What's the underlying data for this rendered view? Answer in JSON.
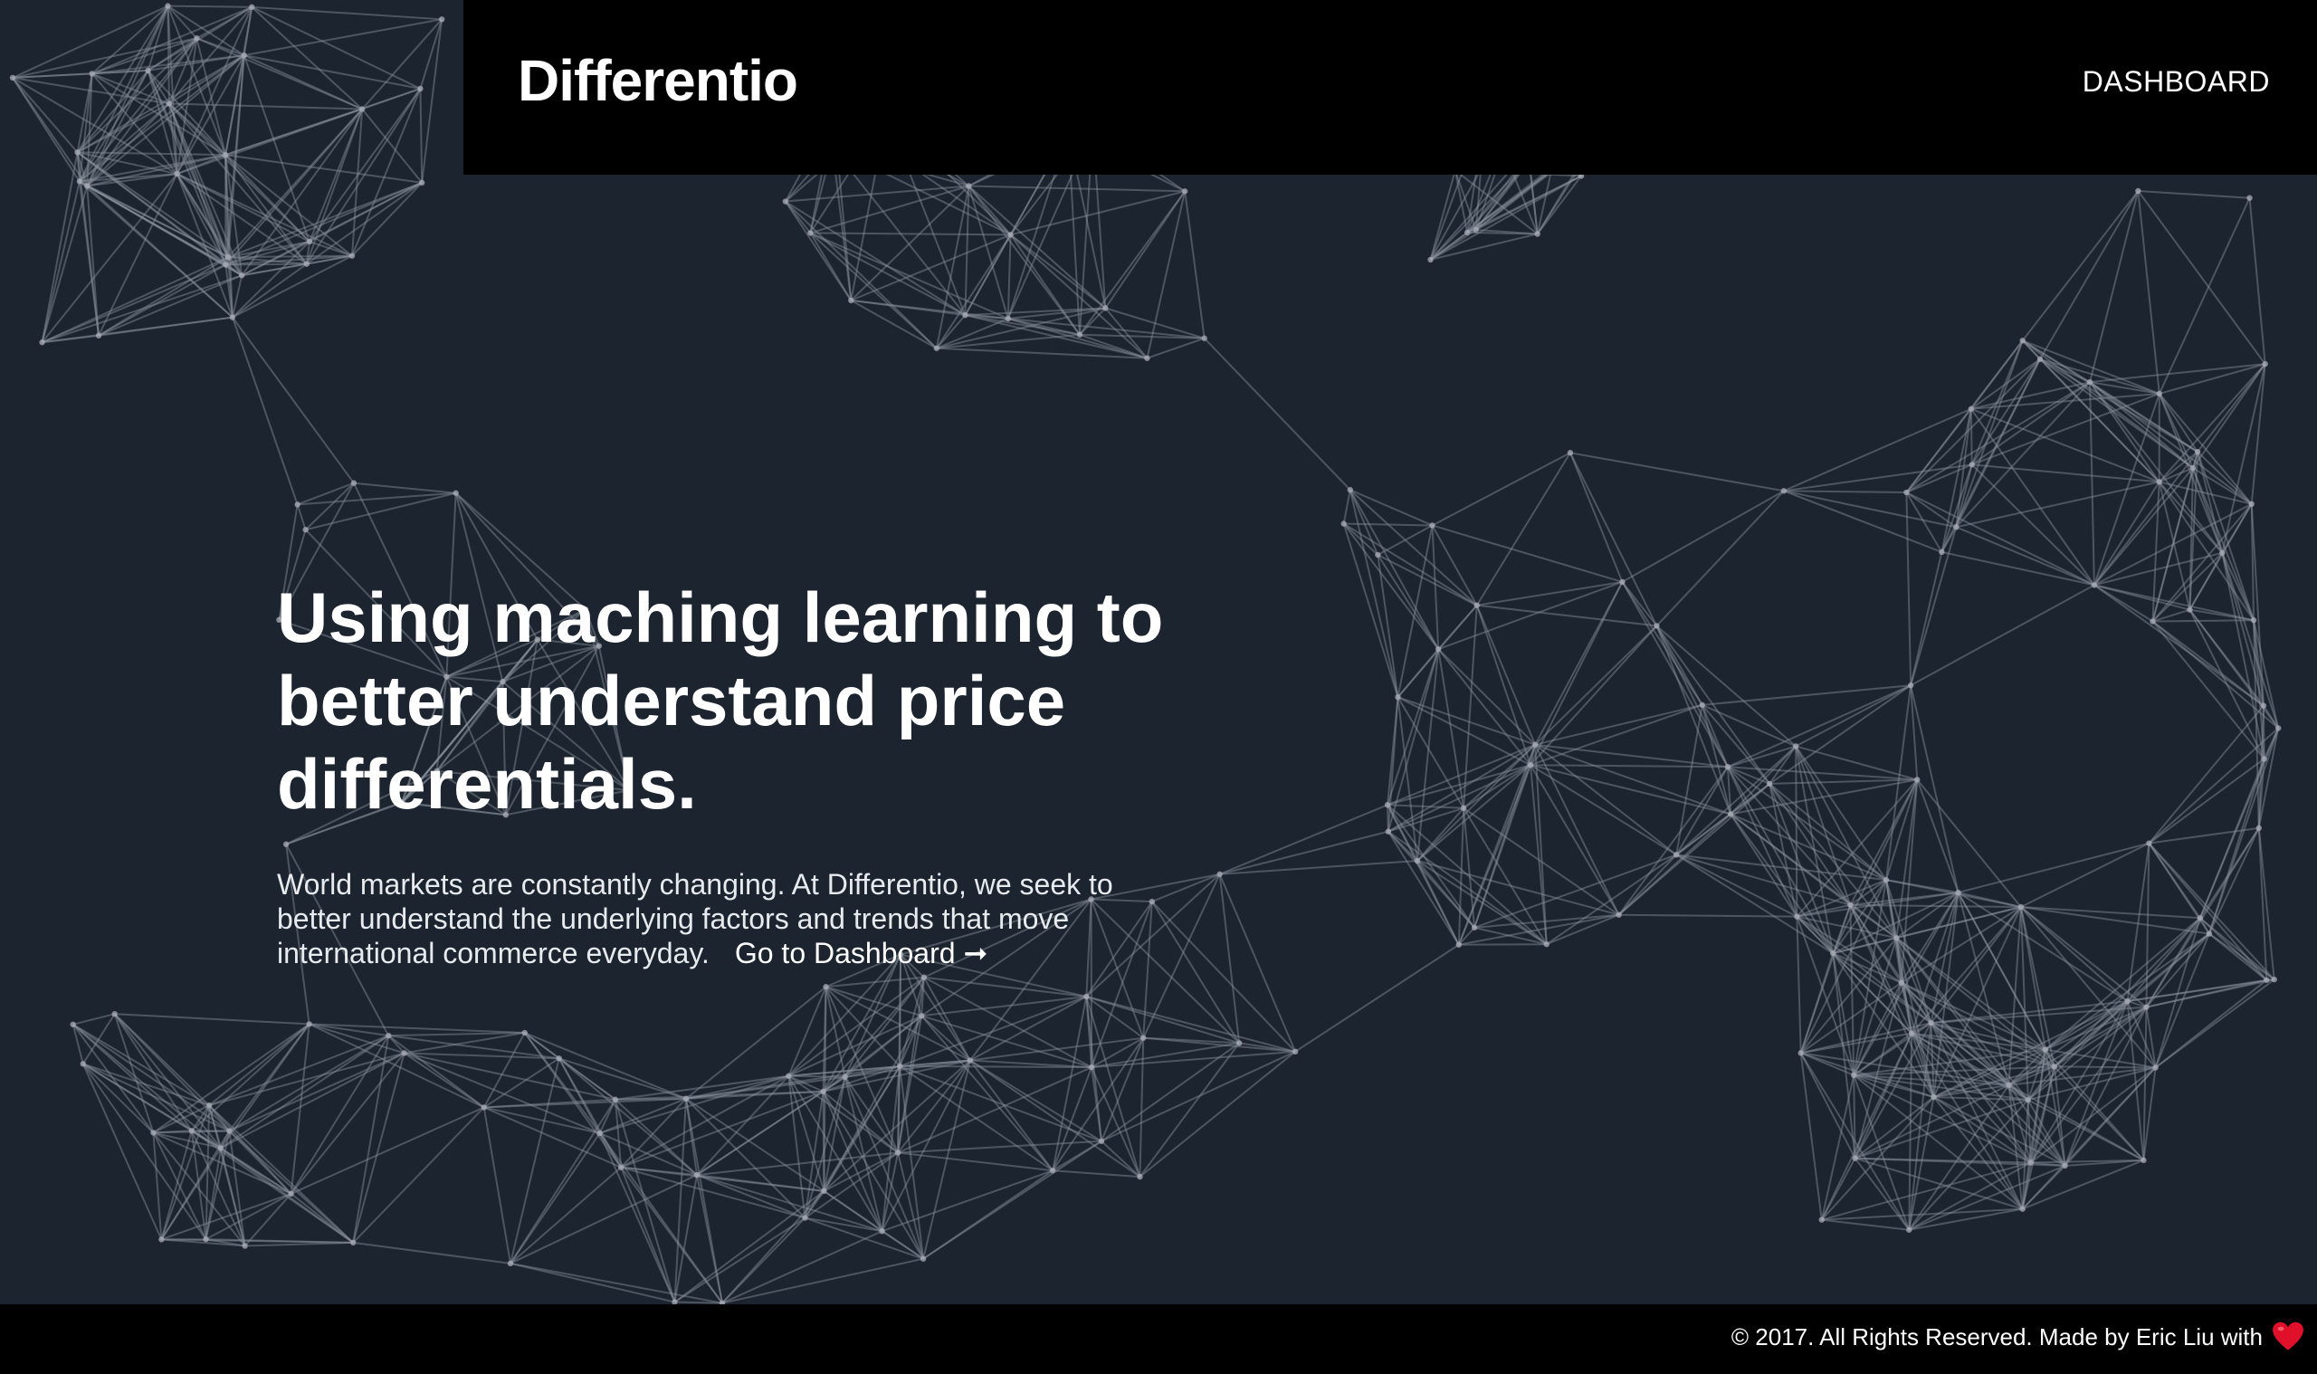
{
  "navbar": {
    "brand": "Differentio",
    "nav_link": "DASHBOARD"
  },
  "hero": {
    "title": "Using maching learning to better understand price differentials.",
    "description": "World markets are constantly changing. At Differentio, we seek to better understand the underlying factors and trends that move international commerce everyday.",
    "link_label": "Go to Dashboard ➞"
  },
  "footer": {
    "text": "© 2017. All Rights Reserved. Made by Eric Liu with",
    "icon": "heart-icon"
  },
  "colors": {
    "background": "#1c2430",
    "bar": "#000000",
    "text": "#ffffff",
    "heart": "#e0102a"
  }
}
